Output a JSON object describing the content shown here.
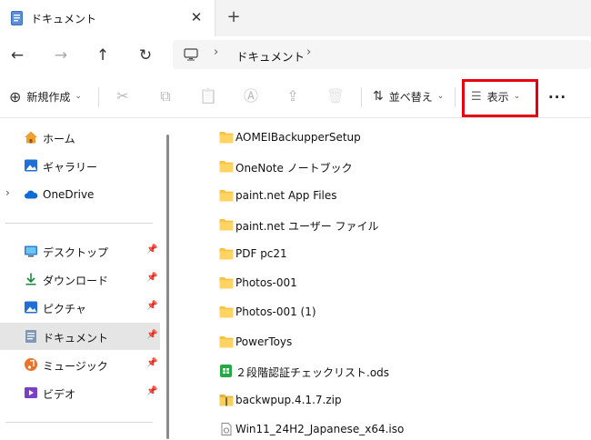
{
  "tab": {
    "title": "ドキュメント",
    "close_glyph": "✕",
    "new_tab_glyph": "+"
  },
  "nav": {
    "back": "←",
    "forward": "→",
    "up": "↑",
    "refresh": "↻"
  },
  "address": {
    "sep1": "›",
    "location": "ドキュメント",
    "sep2": "›"
  },
  "commands": {
    "new_label": "新規作成",
    "new_icon_glyph": "⊕",
    "sort_label": "並べ替え",
    "sort_icon_glyph": "⇅",
    "view_label": "表示",
    "view_icon_glyph": "☰",
    "chevron": "⌄",
    "cut_glyph": "✂",
    "copy_glyph": "⧉",
    "paste_glyph": "📋",
    "rename_glyph": "Ⓐ",
    "share_glyph": "⇪",
    "delete_glyph": "🗑",
    "more_glyph": "···"
  },
  "highlight_color": "#e60012",
  "sidebar": {
    "pin_glyph": "📌",
    "expander_glyph": "›",
    "items": [
      {
        "label": "ホーム",
        "icon": "home-icon"
      },
      {
        "label": "ギャラリー",
        "icon": "gallery-icon"
      },
      {
        "label": "OneDrive",
        "icon": "cloud-icon"
      },
      {
        "label": "デスクトップ",
        "icon": "desktop-icon"
      },
      {
        "label": "ダウンロード",
        "icon": "download-icon"
      },
      {
        "label": "ピクチャ",
        "icon": "pictures-icon"
      },
      {
        "label": "ドキュメント",
        "icon": "documents-icon"
      },
      {
        "label": "ミュージック",
        "icon": "music-icon"
      },
      {
        "label": "ビデオ",
        "icon": "video-icon"
      }
    ]
  },
  "files": [
    {
      "name": "AOMEIBackupperSetup",
      "type": "folder"
    },
    {
      "name": "OneNote ノートブック",
      "type": "folder"
    },
    {
      "name": "paint.net App Files",
      "type": "folder"
    },
    {
      "name": "paint.net ユーザー ファイル",
      "type": "folder"
    },
    {
      "name": "PDF pc21",
      "type": "folder"
    },
    {
      "name": "Photos-001",
      "type": "folder"
    },
    {
      "name": "Photos-001 (1)",
      "type": "folder"
    },
    {
      "name": "PowerToys",
      "type": "folder"
    },
    {
      "name": "２段階認証チェックリスト.ods",
      "type": "spreadsheet"
    },
    {
      "name": "backwpup.4.1.7.zip",
      "type": "zip"
    },
    {
      "name": "Win11_24H2_Japanese_x64.iso",
      "type": "iso"
    }
  ]
}
